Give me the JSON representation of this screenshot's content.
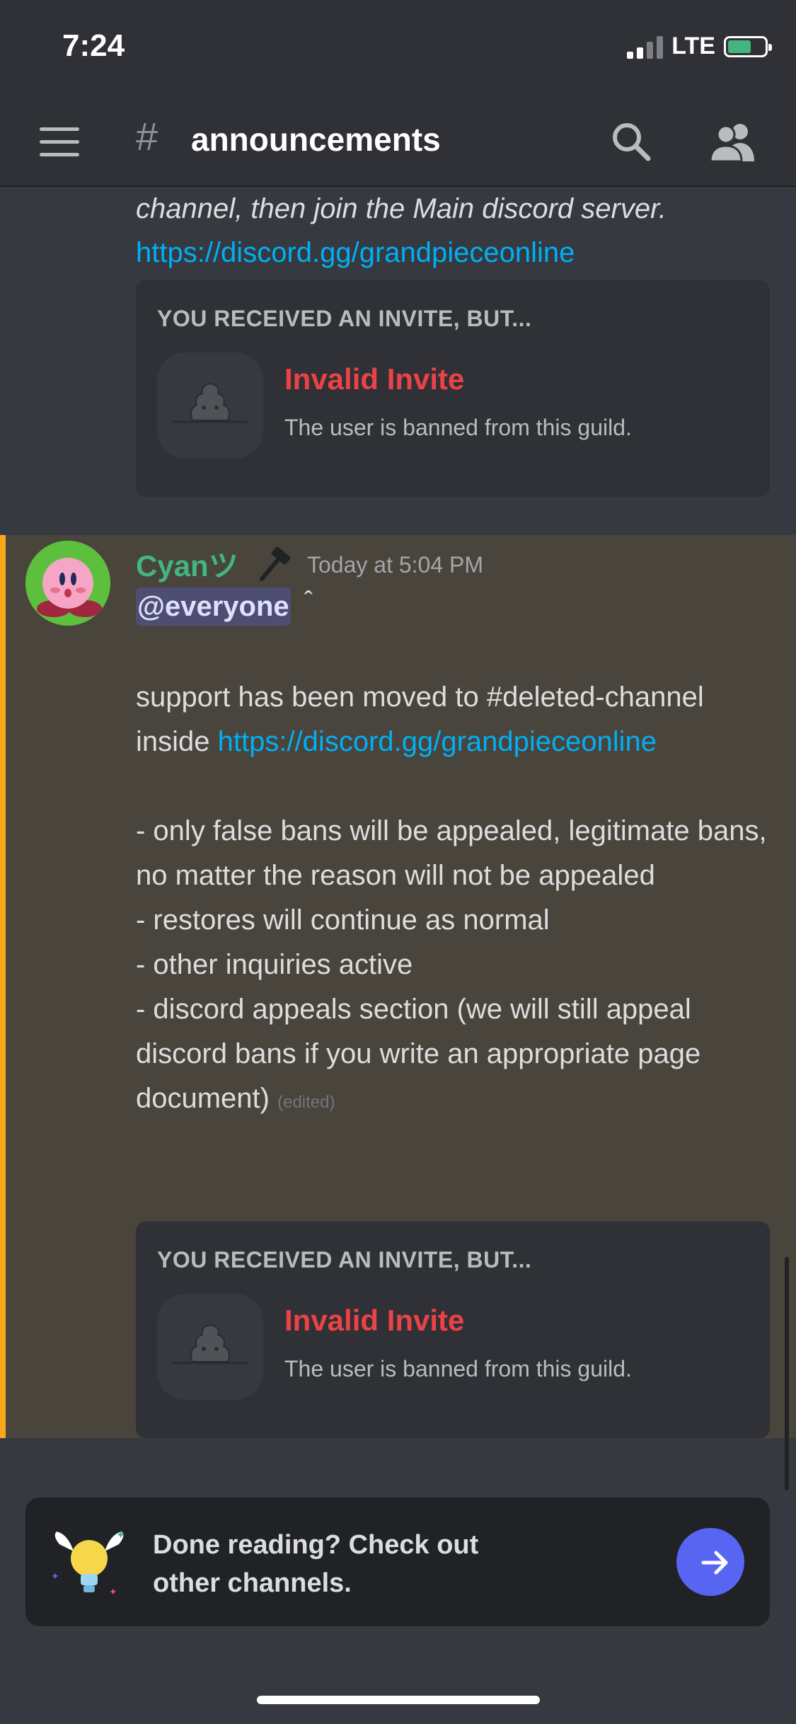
{
  "status_bar": {
    "time": "7:24",
    "network": "LTE"
  },
  "header": {
    "channel_name": "announcements",
    "icons": [
      "hamburger-icon",
      "hash-icon",
      "search-icon",
      "members-icon"
    ]
  },
  "previous_message": {
    "text_italic": "channel, then join the Main discord server.",
    "link": "https://discord.gg/grandpieceonline",
    "invite": {
      "heading": "YOU RECEIVED AN INVITE, BUT...",
      "title": "Invalid Invite",
      "description": "The user is banned from this guild."
    }
  },
  "message": {
    "username": "Cyanツ",
    "timestamp": "Today at 5:04 PM",
    "mention": "@everyone",
    "caret": "ˆ",
    "line1_text": "support has been moved to #deleted-channel inside ",
    "line1_link": "https://discord.gg/grandpieceonline",
    "bullets": [
      "- only false bans will be appealed, legitimate bans, no matter the reason will not be appealed",
      "- restores will continue as normal",
      "- other inquiries active",
      "- discord appeals section (we will still appeal discord bans if you write an appropriate page document)"
    ],
    "edited_label": "(edited)",
    "invite": {
      "heading": "YOU RECEIVED AN INVITE, BUT...",
      "title": "Invalid Invite",
      "description": "The user is banned from this guild."
    }
  },
  "banner": {
    "text": "Done reading? Check out other channels."
  },
  "colors": {
    "background": "#36393f",
    "header": "#2f3136",
    "link": "#00aff4",
    "error": "#ed4245",
    "username": "#43b581",
    "highlight_bar": "#faa81a",
    "blurple": "#5865f2"
  }
}
